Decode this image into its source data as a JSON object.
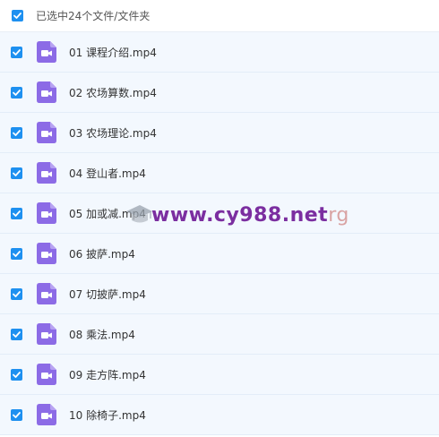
{
  "header": {
    "selected_label": "已选中24个文件/文件夹",
    "checked": true
  },
  "files": [
    {
      "name": "01 课程介绍.mp4",
      "checked": true
    },
    {
      "name": "02 农场算数.mp4",
      "checked": true
    },
    {
      "name": "03 农场理论.mp4",
      "checked": true
    },
    {
      "name": "04 登山者.mp4",
      "checked": true
    },
    {
      "name": "05 加或减.mp4",
      "checked": true
    },
    {
      "name": "06 披萨.mp4",
      "checked": true
    },
    {
      "name": "07 切披萨.mp4",
      "checked": true
    },
    {
      "name": "08 乘法.mp4",
      "checked": true
    },
    {
      "name": "09 走方阵.mp4",
      "checked": true
    },
    {
      "name": "10 除椅子.mp4",
      "checked": true
    }
  ],
  "watermark": {
    "text": "www.cy988.net",
    "suffix": "rg"
  },
  "colors": {
    "checkbox": "#1e90f0",
    "video_icon": "#8c6be6",
    "row_bg": "#f3f8fe"
  },
  "icons": {
    "checkbox": "checkmark-icon",
    "file": "video-file-icon"
  }
}
